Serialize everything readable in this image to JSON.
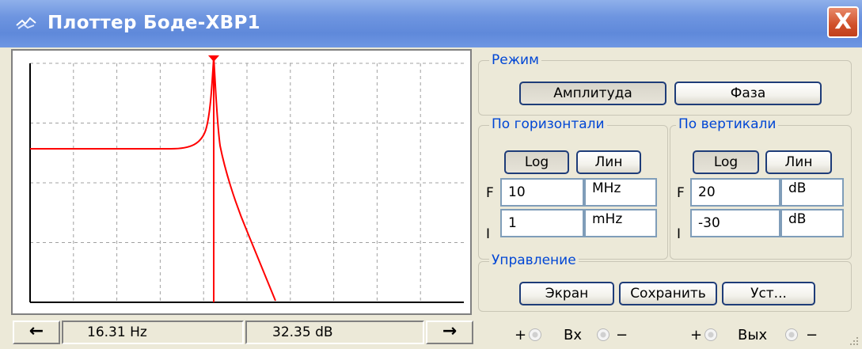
{
  "window": {
    "title": "Плоттер Боде-XBP1",
    "close_label": "X"
  },
  "status_bar": {
    "frequency": "16.31 Hz",
    "magnitude": "32.35 dB",
    "left_arrow": "←",
    "right_arrow": "→"
  },
  "mode": {
    "label": "Режим",
    "amplitude_label": "Амплитуда",
    "phase_label": "Фаза",
    "selected": "Амплитуда"
  },
  "horizontal": {
    "label": "По горизонтали",
    "log_label": "Log",
    "lin_label": "Лин",
    "selected": "Log",
    "f_label": "F",
    "f_value": "10",
    "f_unit": "MHz",
    "i_label": "I",
    "i_value": "1",
    "i_unit": "mHz"
  },
  "vertical": {
    "label": "По вертикали",
    "log_label": "Log",
    "lin_label": "Лин",
    "selected": "Log",
    "f_label": "F",
    "f_value": "20",
    "f_unit": "dB",
    "i_label": "I",
    "i_value": "-30",
    "i_unit": "dB"
  },
  "control": {
    "label": "Управление",
    "screen_label": "Экран",
    "save_label": "Сохранить",
    "settings_label": "Уст..."
  },
  "terminals": {
    "in_label": "Вх",
    "out_label": "Вых",
    "plus": "+",
    "minus": "−"
  },
  "colors": {
    "trace": "#ff0000",
    "cursor": "#ff0000",
    "title_bar": "#6e95e0",
    "accent_text": "#0046d5"
  }
}
